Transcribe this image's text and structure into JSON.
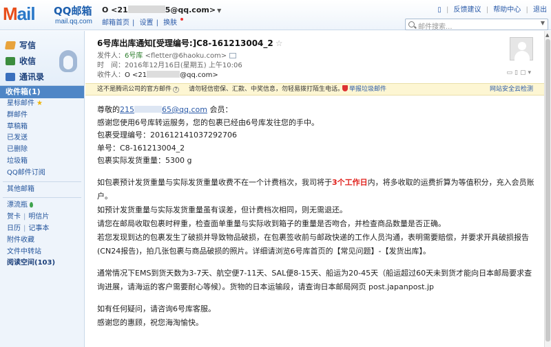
{
  "brand": {
    "logo_text": "Mail",
    "title": "QQ邮箱",
    "url": "mail.qq.com"
  },
  "account": {
    "prefix": "O <21",
    "suffix": "5@qq.com>",
    "links": [
      "邮箱首页",
      "设置",
      "换肤"
    ]
  },
  "top_links": [
    "反馈建议",
    "帮助中心",
    "退出"
  ],
  "search": {
    "placeholder": "邮件搜索..."
  },
  "sidebar": {
    "write": "写信",
    "receive": "收信",
    "contacts": "通讯录",
    "inbox": "收件箱(1)",
    "folders_a": [
      "星标邮件",
      "群邮件",
      "草稿箱",
      "已发送",
      "已删除",
      "垃圾箱",
      "QQ邮件订阅"
    ],
    "other_mailbox": "其他邮箱",
    "drift_bottle": "漂流瓶",
    "card": "贺卡",
    "postcard": "明信片",
    "calendar": "日历",
    "notebook": "记事本",
    "attachments": "附件收藏",
    "transfer": "文件中转站",
    "reading_space": "阅读空间(103)"
  },
  "mail": {
    "subject": "6号库出库通知[受理编号:]C8-161213004_2",
    "from_label": "发件人：",
    "from_name": "6号库",
    "from_addr": "<fletter@6haoku.com>",
    "time_label": "时　间：",
    "time_value": "2016年12月16日(星期五) 上午10:06",
    "to_label": "收件人：",
    "to_prefix": "O <21",
    "to_suffix": "@qq.com>"
  },
  "notice": {
    "official": "这不是腾讯公司的官方邮件",
    "warning": "请勿轻信密保、汇款、中奖信息，勿轻易拨打陌生电话。",
    "report": "举报垃圾邮件",
    "cloud": "网站安全云检测"
  },
  "body": {
    "greeting_prefix": "尊敬的",
    "greeting_email_a": "215",
    "greeting_email_b": "65@qq.com",
    "greeting_suffix": " 会员：",
    "line1": "感谢您使用6号库转运服务，您的包裹已经由6号库发往您的手中。",
    "line2": "包裹受理编号：201612141037292706",
    "line3": "单号：C8-161213004_2",
    "line4": "包裹实际发货重量：5300 g",
    "p1_a": "如包裹预计发货重量与实际发货重量收费不在一个计费档次，我司将于",
    "p1_red": "3个工作日",
    "p1_b": "内，将多收取的运费折算为等值积分，充入会员账户。",
    "p2": "如预计发货重量与实际发货重量虽有误差，但计费档次相同，则无需退还。",
    "p3": "请您在邮局收取包裹时秤重，检查面单重量与实际收到箱子的重量是否吻合，并检查商品数量是否正确。",
    "p4": "若您发现到达的包裹发生了破损并导致物品破损，在包裹签收前与邮政快递的工作人员沟通，表明需要赔偿，并要求开具破损报告(CN24报告)，拍几张包裹与商品破损的照片。详细请浏览6号库首页的【常见问题】-【发货出库】。",
    "p5": "通常情况下EMS到货天数为3-7天、航空便7-11天、SAL便8-15天、船运为20-45天（船运超过60天未到货才能向日本邮局要求查询进展，请海运的客户需要耐心等候）。货物的日本运输段，请查询日本邮局网页 post.japanpost.jp",
    "p6": "如有任何疑问，请咨询6号库客服。",
    "p7": "感谢您的惠顾，祝您海淘愉快。"
  },
  "colors": {
    "accent_blue": "#2a5aa8",
    "inbox_highlight": "#4f86c6",
    "notice_bg": "#fdf6d3",
    "highlight_red": "#e0211c"
  }
}
